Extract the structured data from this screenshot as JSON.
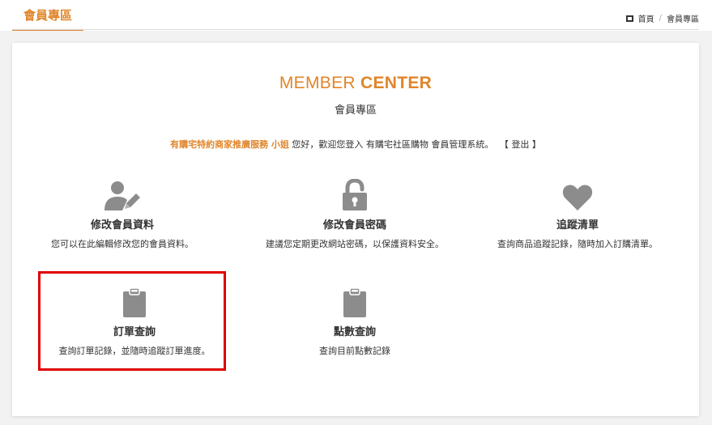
{
  "header": {
    "title": "會員專區",
    "breadcrumb": {
      "home": "首頁",
      "separator": "/",
      "current": "會員專區"
    }
  },
  "main": {
    "heading_light": "MEMBER ",
    "heading_bold": "CENTER",
    "subheading": "會員專區",
    "welcome": {
      "member_name": "有購宅特約商家推廣服務 小姐",
      "text": "您好，歡迎您登入 有購宅社區購物 會員管理系統。",
      "logout": "【 登出 】"
    },
    "tiles": [
      {
        "icon": "user-edit-icon",
        "title": "修改會員資料",
        "desc": "您可以在此編輯修改您的會員資料。"
      },
      {
        "icon": "unlock-icon",
        "title": "修改會員密碼",
        "desc": "建議您定期更改網站密碼，以保護資料安全。"
      },
      {
        "icon": "heart-icon",
        "title": "追蹤清單",
        "desc": "查詢商品追蹤記錄，隨時加入訂購清單。"
      },
      {
        "icon": "clipboard-icon",
        "title": "訂單查詢",
        "desc": "查詢訂單記錄，並隨時追蹤訂單進度。"
      },
      {
        "icon": "clipboard-icon",
        "title": "點數查詢",
        "desc": "查詢目前點數記錄"
      }
    ]
  },
  "colors": {
    "accent": "#e0852a",
    "icon": "#8c8c8c",
    "highlight": "#e00000"
  }
}
